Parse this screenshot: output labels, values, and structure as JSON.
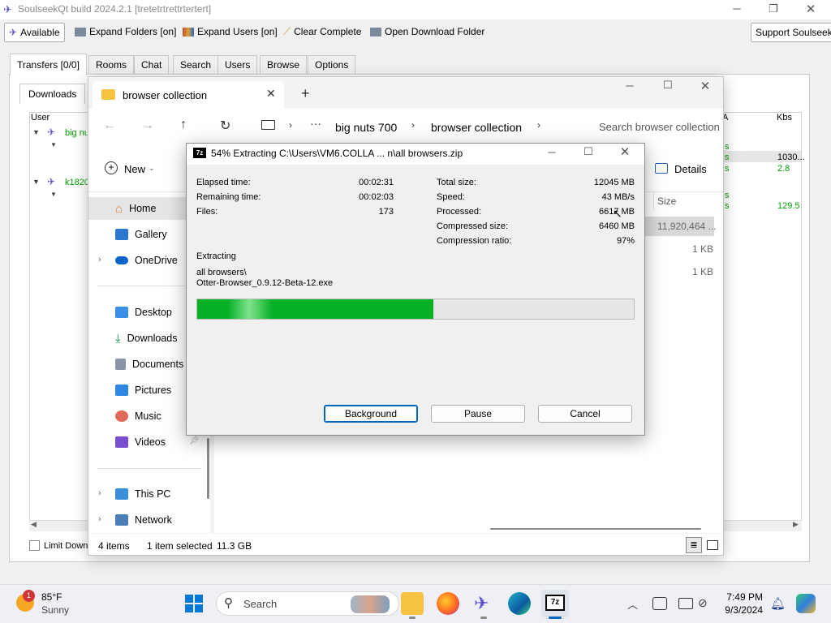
{
  "soulseek": {
    "title": "SoulseekQt build 2024.2.1 [tretetrtrettrtertert]",
    "toolbar": {
      "available": "Available",
      "expand_folders": "Expand Folders [on]",
      "expand_users": "Expand Users [on]",
      "clear_complete": "Clear Complete",
      "open_download_folder": "Open Download Folder",
      "support": "Support Soulseek!"
    },
    "tabs": [
      "Transfers [0/0]",
      "Rooms",
      "Chat",
      "Search",
      "Users",
      "Browse",
      "Options"
    ],
    "subtab": "Downloads",
    "columns": {
      "user": "User",
      "a": "A",
      "kbs": "Kbs"
    },
    "users": [
      "big nu",
      "k1820"
    ],
    "kbs_values": [
      "1030...",
      "2.8",
      "129.5"
    ],
    "status_fragments": [
      "s",
      "s",
      "s",
      "s",
      "s",
      "s"
    ],
    "limit_label": "Limit Downl"
  },
  "explorer": {
    "tab_title": "browser collection",
    "breadcrumb": [
      "big nuts 700",
      "browser collection"
    ],
    "search_placeholder": "Search browser collection",
    "new_label": "New",
    "details_label": "Details",
    "size_header": "Size",
    "sizes": [
      "11,920,464 ...",
      "1 KB",
      "1 KB"
    ],
    "nav": {
      "home": "Home",
      "gallery": "Gallery",
      "onedrive": "OneDrive",
      "desktop": "Desktop",
      "downloads": "Downloads",
      "documents": "Documents",
      "pictures": "Pictures",
      "music": "Music",
      "videos": "Videos",
      "this_pc": "This PC",
      "network": "Network"
    },
    "status": {
      "items": "4 items",
      "selected": "1 item selected",
      "size": "11.3 GB"
    }
  },
  "sevenzip": {
    "logo": "7z",
    "title": "54% Extracting C:\\Users\\VM6.COLLA ... n\\all browsers.zip",
    "left_labels": [
      "Elapsed time:",
      "Remaining time:",
      "Files:"
    ],
    "left_values": [
      "00:02:31",
      "00:02:03",
      "173"
    ],
    "right_labels": [
      "Total size:",
      "Speed:",
      "Processed:",
      "Compressed size:",
      "Compression ratio:"
    ],
    "right_values": [
      "12045 MB",
      "43 MB/s",
      "6617 MB",
      "6460 MB",
      "97%"
    ],
    "operation": "Extracting",
    "path_line1": "all browsers\\",
    "path_line2": "Otter-Browser_0.9.12-Beta-12.exe",
    "progress": 0.54,
    "buttons": {
      "background": "Background",
      "pause": "Pause",
      "cancel": "Cancel"
    }
  },
  "taskbar": {
    "weather_temp": "85°F",
    "weather_desc": "Sunny",
    "weather_badge": "1",
    "search_label": "Search",
    "time": "7:49 PM",
    "date": "9/3/2024"
  },
  "colors": {
    "progress_green": "#06b025",
    "soulseek_green": "#00a000",
    "accent_blue": "#0067c0"
  }
}
